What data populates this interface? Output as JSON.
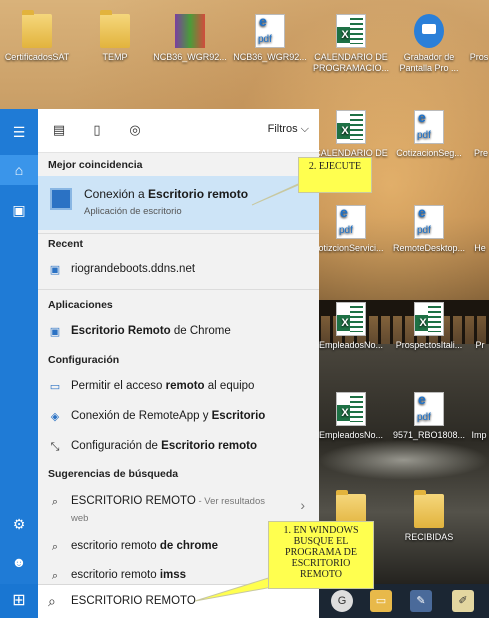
{
  "desktop": {
    "icons": [
      {
        "label": "CertificadosSAT",
        "type": "folder"
      },
      {
        "label": "TEMP",
        "type": "folder"
      },
      {
        "label": "NCB36_WGR92...",
        "type": "zip"
      },
      {
        "label": "NCB36_WGR92...",
        "type": "pdf"
      },
      {
        "label": "CALENDARIO DE PROGRAMACIO...",
        "type": "xls"
      },
      {
        "label": "Grabador de Pantalla Pro ...",
        "type": "cam"
      },
      {
        "label": "Pros",
        "type": "generic"
      },
      {
        "label": "CALENDARIO DE PROG...",
        "type": "xls"
      },
      {
        "label": "CotizacionSeg...",
        "type": "pdf"
      },
      {
        "label": "Pre",
        "type": "generic"
      },
      {
        "label": "otizcionServici...",
        "type": "pdf"
      },
      {
        "label": "RemoteDesktop...",
        "type": "pdf"
      },
      {
        "label": "He",
        "type": "generic"
      },
      {
        "label": "EmpleadosNo...",
        "type": "xls"
      },
      {
        "label": "ProspectosItali...",
        "type": "xls"
      },
      {
        "label": "Pr",
        "type": "generic"
      },
      {
        "label": "EmpleadosNo...",
        "type": "xls"
      },
      {
        "label": "9571_RBO1808...",
        "type": "pdf"
      },
      {
        "label": "Imp",
        "type": "generic"
      },
      {
        "label": "RECIBIDAS",
        "type": "folder"
      }
    ]
  },
  "start_menu": {
    "rail_icons": [
      "hamburger-icon",
      "home-icon",
      "notebook-icon",
      "settings-icon",
      "feedback-icon"
    ],
    "top_tabs": [
      "apps-icon",
      "document-icon",
      "web-icon"
    ],
    "filters_label": "Filtros",
    "best_match_header": "Mejor coincidencia",
    "best_match": {
      "title_pre": "Conexión a ",
      "title_bold": "Escritorio remoto",
      "subtitle": "Aplicación de escritorio"
    },
    "recent_header": "Recent",
    "recent": [
      {
        "text": "riograndeboots.ddns.net"
      }
    ],
    "apps_header": "Aplicaciones",
    "apps": [
      {
        "bold": "Escritorio Remoto",
        "post": " de Chrome"
      }
    ],
    "config_header": "Configuración",
    "config": [
      {
        "pre": "Permitir el acceso ",
        "bold": "remoto",
        "post": " al equipo"
      },
      {
        "pre": "Conexión de RemoteApp y ",
        "bold": "Escritorio",
        "post": ""
      },
      {
        "pre": "Configuración de ",
        "bold": "Escritorio remoto",
        "post": ""
      }
    ],
    "suggestions_header": "Sugerencias de búsqueda",
    "suggestions": [
      {
        "main": "ESCRITORIO REMOTO",
        "sub1": " - Ver resultados",
        "sub2": "web"
      },
      {
        "pre": "escritorio remoto ",
        "bold": "de chrome"
      },
      {
        "pre": "escritorio remoto ",
        "bold": "imss"
      }
    ],
    "search_value": "ESCRITORIO REMOTO"
  },
  "callouts": {
    "step2": "2. EJECUTE",
    "step1": [
      "1. EN WINDOWS",
      "BUSQUE EL",
      "PROGRAMA DE",
      "ESCRITORIO",
      "REMOTO"
    ]
  },
  "taskbar": {
    "icons": [
      "start-icon",
      "chrome-icon",
      "explorer-icon",
      "tool-icon",
      "paint-icon"
    ]
  }
}
